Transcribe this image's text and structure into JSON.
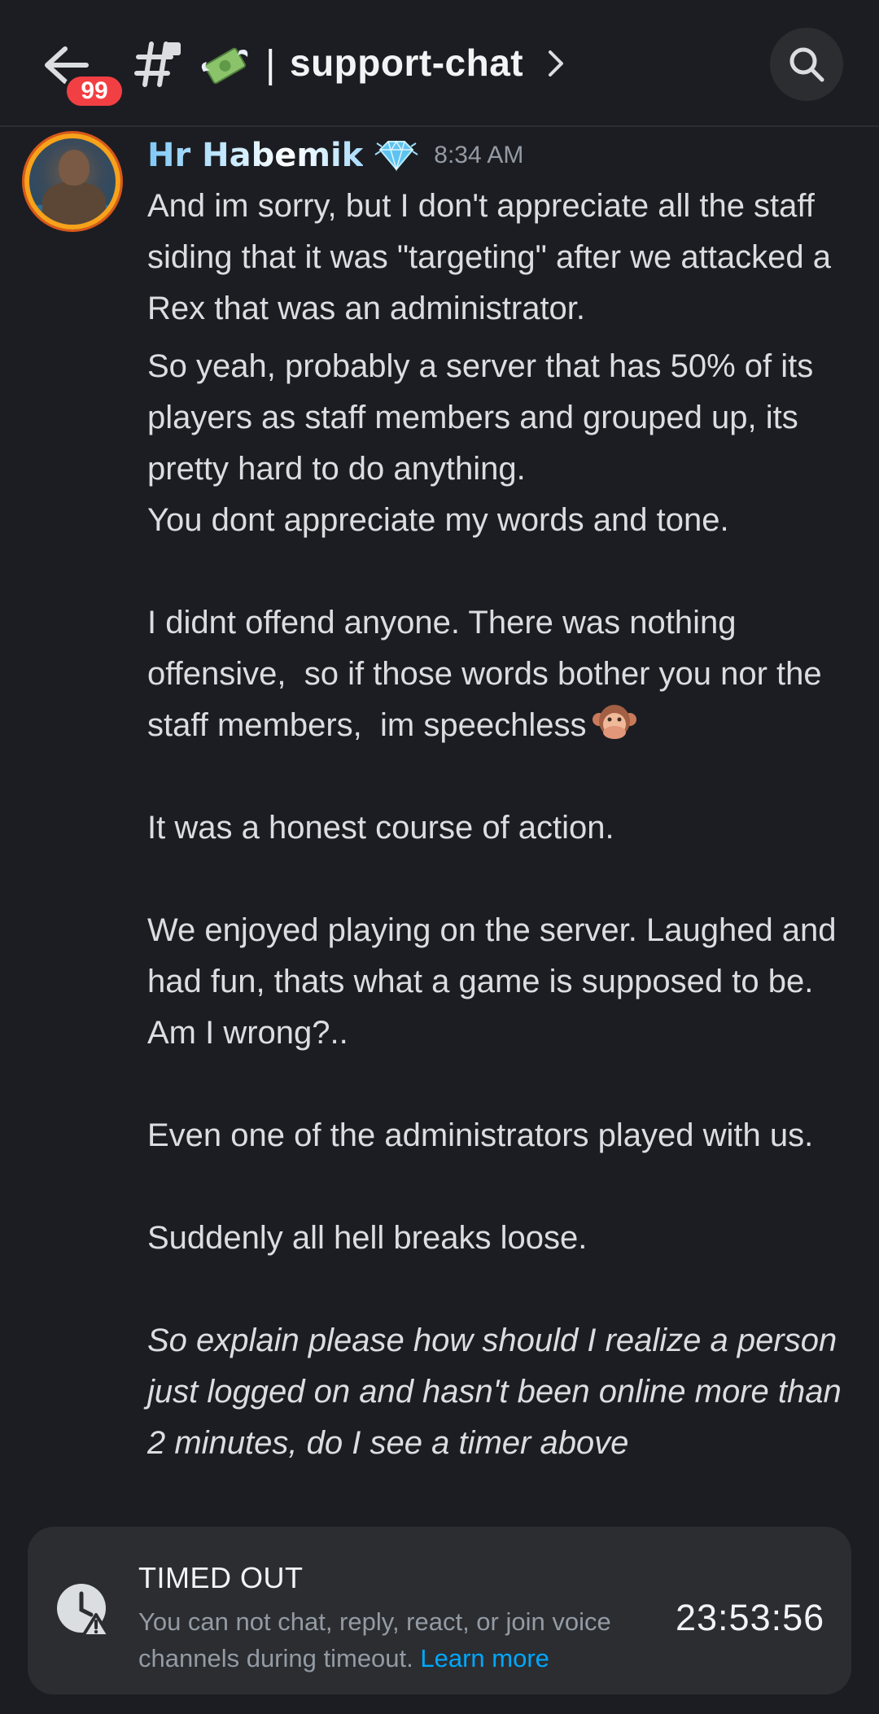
{
  "header": {
    "unread_count": "99",
    "channel_emoji": "money-with-wings",
    "separator": "|",
    "channel_name": "support-chat"
  },
  "message": {
    "author": "Hr Habemik",
    "timestamp": "8:34 AM",
    "role_icon": "diamond-icon",
    "paragraphs": [
      "And im sorry, but I don't appreciate all the staff siding that it was \"targeting\" after we attacked a Rex that was an administrator.",
      "So yeah, probably a server that has 50% of its players as staff members and grouped up, its pretty hard to do anything.",
      "You dont appreciate my words and tone.",
      "I didnt offend anyone. There was nothing offensive,  so if those words bother you nor the staff members,  im speechless",
      "It was a honest course of action.",
      "We enjoyed playing on the server. Laughed and had fun, thats what a game is supposed to be. Am I wrong?..",
      "Even one of the administrators played with us.",
      "Suddenly all hell breaks loose.",
      "So explain please how should I realize a person just logged on and hasn't been online more than 2 minutes, do I see a timer above"
    ]
  },
  "timeout": {
    "title": "TIMED OUT",
    "description": "You can not chat, reply, react, or join voice channels during timeout.",
    "link": "Learn more",
    "timer": "23:53:56"
  },
  "colors": {
    "background": "#1c1d22",
    "badge": "#f23f43",
    "link": "#00a8fc",
    "panel": "#2b2d31"
  }
}
